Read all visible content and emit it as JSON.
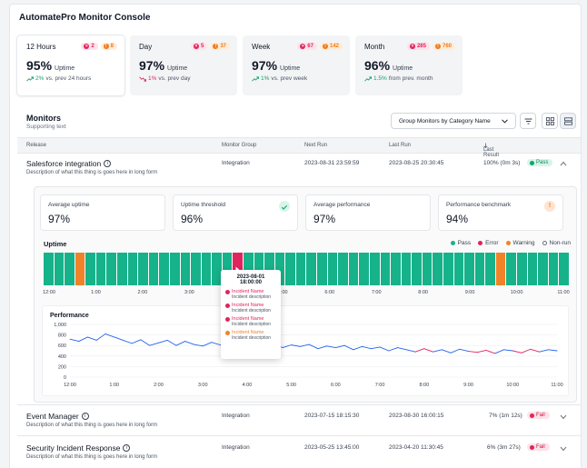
{
  "app_title": "AutomatePro Monitor Console",
  "colors": {
    "pass": "#16b28a",
    "error": "#e0245e",
    "warning": "#f0832a",
    "line_blue": "#2563eb",
    "line_red": "#e0245e"
  },
  "stats": [
    {
      "period": "12 Hours",
      "errors": "2",
      "warnings": "8",
      "value": "95%",
      "unit": "Uptime",
      "delta": "2%",
      "delta_dir": "up",
      "delta_text": "vs. prev 24 hours"
    },
    {
      "period": "Day",
      "errors": "5",
      "warnings": "37",
      "value": "97%",
      "unit": "Uptime",
      "delta": "1%",
      "delta_dir": "down",
      "delta_text": "vs. prev day"
    },
    {
      "period": "Week",
      "errors": "67",
      "warnings": "142",
      "value": "97%",
      "unit": "Uptime",
      "delta": "1%",
      "delta_dir": "up",
      "delta_text": "vs. prev week"
    },
    {
      "period": "Month",
      "errors": "285",
      "warnings": "760",
      "value": "96%",
      "unit": "Uptime",
      "delta": "1.5%",
      "delta_dir": "up",
      "delta_text": "from prev. month"
    }
  ],
  "monitors": {
    "title": "Monitors",
    "subtitle": "Supporting text",
    "group_by": "Group Monitors by Category Name",
    "columns": {
      "release": "Release",
      "group": "Monitor Group",
      "next": "Next Run",
      "last": "Last Run",
      "result": "Last Result"
    },
    "rows": [
      {
        "name": "Salesforce integration",
        "desc": "Description of what this thing is goes here in long form",
        "group": "Integration",
        "next": "2023-08-31 23:59:59",
        "last": "2023-08-25 20:30:45",
        "result": "100% (0m 3s)",
        "status": "Pass"
      },
      {
        "name": "Event Manager",
        "desc": "Description of what this thing is goes here in long form",
        "group": "Integration",
        "next": "2023-07-15 18:15:30",
        "last": "2023-08-30 16:00:15",
        "result": "7% (1m 12s)",
        "status": "Fail"
      },
      {
        "name": "Security Incident Response",
        "desc": "Description of what this thing is goes here in long form",
        "group": "Integration",
        "next": "2023-05-25 13:45:00",
        "last": "2023-04-20 11:30:45",
        "result": "6% (3m 27s)",
        "status": "Fail"
      }
    ]
  },
  "detail": {
    "kpis": [
      {
        "label": "Average uptime",
        "value": "97%"
      },
      {
        "label": "Uptime threshold",
        "value": "96%"
      },
      {
        "label": "Average performance",
        "value": "97%"
      },
      {
        "label": "Performance benchmark",
        "value": "94%"
      }
    ],
    "uptime_title": "Uptime",
    "legend": [
      "Pass",
      "Error",
      "Warning",
      "Non-run"
    ],
    "uptime_segments": [
      "p",
      "p",
      "p",
      "w",
      "p",
      "p",
      "p",
      "p",
      "p",
      "p",
      "p",
      "p",
      "p",
      "p",
      "p",
      "p",
      "p",
      "p",
      "e",
      "p",
      "p",
      "p",
      "p",
      "p",
      "p",
      "p",
      "p",
      "p",
      "p",
      "p",
      "p",
      "p",
      "p",
      "p",
      "p",
      "p",
      "p",
      "p",
      "p",
      "p",
      "p",
      "p",
      "p",
      "w",
      "p",
      "p",
      "p",
      "p",
      "p",
      "p"
    ],
    "uptime_ticks": [
      "12:00",
      "1:00",
      "2:00",
      "3:00",
      "4:00",
      "5:00",
      "6:00",
      "7:00",
      "8:00",
      "9:00",
      "10:00",
      "11:00"
    ],
    "perf_title": "Performance",
    "tooltip": {
      "time": "2023-08-01 18:00:00",
      "items": [
        {
          "name": "Incident Name",
          "desc": "Incident description",
          "type": "error"
        },
        {
          "name": "Incident Name",
          "desc": "Incident description",
          "type": "error"
        },
        {
          "name": "Incident Name",
          "desc": "Incident description",
          "type": "error"
        },
        {
          "name": "Incident Name",
          "desc": "Incident description",
          "type": "warning"
        }
      ]
    }
  },
  "chart_data": {
    "type": "line",
    "title": "Performance",
    "xlabel": "",
    "ylabel": "",
    "x_ticks": [
      "12:00",
      "1:00",
      "2:00",
      "3:00",
      "4:00",
      "5:00",
      "6:00",
      "7:00",
      "8:00",
      "9:00",
      "10:00",
      "11:00"
    ],
    "y_ticks": [
      0,
      200,
      400,
      600,
      800,
      1000
    ],
    "ylim": [
      0,
      1000
    ],
    "xlim": [
      0,
      11
    ],
    "grid": true,
    "series": [
      {
        "values": [
          [
            0,
            720
          ],
          [
            0.2,
            680
          ],
          [
            0.4,
            760
          ],
          [
            0.6,
            700
          ],
          [
            0.8,
            820
          ],
          [
            1.0,
            760
          ],
          [
            1.2,
            700
          ],
          [
            1.4,
            640
          ],
          [
            1.6,
            710
          ],
          [
            1.8,
            600
          ],
          [
            2.0,
            650
          ],
          [
            2.2,
            700
          ],
          [
            2.4,
            600
          ],
          [
            2.6,
            680
          ],
          [
            2.8,
            620
          ],
          [
            3.0,
            590
          ],
          [
            3.2,
            660
          ],
          [
            3.4,
            610
          ],
          [
            3.6,
            690
          ],
          [
            3.8,
            620
          ],
          [
            4.0,
            580
          ],
          [
            4.2,
            650
          ],
          [
            4.4,
            600
          ],
          [
            4.6,
            630
          ],
          [
            4.8,
            560
          ],
          [
            5.0,
            610
          ],
          [
            5.2,
            580
          ],
          [
            5.4,
            620
          ],
          [
            5.6,
            540
          ],
          [
            5.8,
            590
          ],
          [
            6.0,
            560
          ],
          [
            6.2,
            600
          ],
          [
            6.4,
            520
          ],
          [
            6.6,
            580
          ],
          [
            6.8,
            540
          ],
          [
            7.0,
            570
          ],
          [
            7.2,
            500
          ],
          [
            7.4,
            560
          ],
          [
            7.6,
            520
          ],
          [
            7.8,
            480
          ],
          [
            8.0,
            540
          ],
          [
            8.2,
            480
          ],
          [
            8.4,
            520
          ],
          [
            8.6,
            460
          ],
          [
            8.8,
            530
          ],
          [
            9.0,
            490
          ],
          [
            9.2,
            470
          ],
          [
            9.4,
            510
          ],
          [
            9.6,
            450
          ],
          [
            9.8,
            520
          ],
          [
            10.0,
            500
          ],
          [
            10.2,
            460
          ],
          [
            10.4,
            530
          ],
          [
            10.6,
            480
          ],
          [
            10.8,
            520
          ],
          [
            11.0,
            500
          ]
        ]
      }
    ],
    "red_segments": [
      [
        7.9,
        8.2
      ],
      [
        9.1,
        9.6
      ],
      [
        10.1,
        10.5
      ]
    ]
  }
}
